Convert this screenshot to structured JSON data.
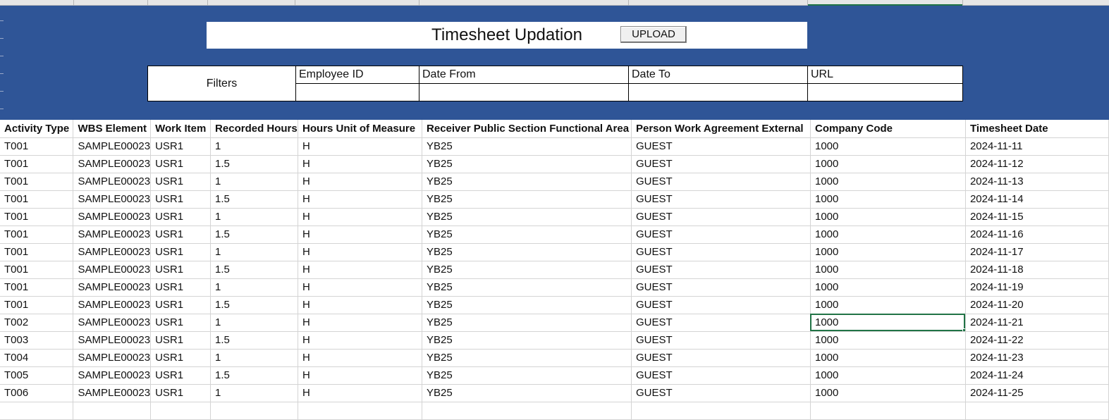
{
  "header": {
    "title": "Timesheet Updation",
    "upload_label": "UPLOAD"
  },
  "filters": {
    "label": "Filters",
    "fields": [
      {
        "label": "Employee ID",
        "value": ""
      },
      {
        "label": "Date From",
        "value": ""
      },
      {
        "label": "Date To",
        "value": ""
      },
      {
        "label": "URL",
        "value": ""
      }
    ]
  },
  "table": {
    "columns": [
      "Activity Type",
      "WBS Element",
      "Work Item",
      "Recorded Hours",
      "Hours Unit of Measure",
      "Receiver Public Section Functional Area",
      "Person Work Agreement External",
      "Company Code",
      "Timesheet Date"
    ],
    "rows": [
      [
        "T001",
        "SAMPLE00023",
        "USR1",
        "1",
        "H",
        "YB25",
        "GUEST",
        "1000",
        "2024-11-11"
      ],
      [
        "T001",
        "SAMPLE00023",
        "USR1",
        "1.5",
        "H",
        "YB25",
        "GUEST",
        "1000",
        "2024-11-12"
      ],
      [
        "T001",
        "SAMPLE00023",
        "USR1",
        "1",
        "H",
        "YB25",
        "GUEST",
        "1000",
        "2024-11-13"
      ],
      [
        "T001",
        "SAMPLE00023",
        "USR1",
        "1.5",
        "H",
        "YB25",
        "GUEST",
        "1000",
        "2024-11-14"
      ],
      [
        "T001",
        "SAMPLE00023",
        "USR1",
        "1",
        "H",
        "YB25",
        "GUEST",
        "1000",
        "2024-11-15"
      ],
      [
        "T001",
        "SAMPLE00023",
        "USR1",
        "1.5",
        "H",
        "YB25",
        "GUEST",
        "1000",
        "2024-11-16"
      ],
      [
        "T001",
        "SAMPLE00023",
        "USR1",
        "1",
        "H",
        "YB25",
        "GUEST",
        "1000",
        "2024-11-17"
      ],
      [
        "T001",
        "SAMPLE00023",
        "USR1",
        "1.5",
        "H",
        "YB25",
        "GUEST",
        "1000",
        "2024-11-18"
      ],
      [
        "T001",
        "SAMPLE00023",
        "USR1",
        "1",
        "H",
        "YB25",
        "GUEST",
        "1000",
        "2024-11-19"
      ],
      [
        "T001",
        "SAMPLE00023",
        "USR1",
        "1.5",
        "H",
        "YB25",
        "GUEST",
        "1000",
        "2024-11-20"
      ],
      [
        "T002",
        "SAMPLE00023",
        "USR1",
        "1",
        "H",
        "YB25",
        "GUEST",
        "1000",
        "2024-11-21"
      ],
      [
        "T003",
        "SAMPLE00023",
        "USR1",
        "1.5",
        "H",
        "YB25",
        "GUEST",
        "1000",
        "2024-11-22"
      ],
      [
        "T004",
        "SAMPLE00023",
        "USR1",
        "1",
        "H",
        "YB25",
        "GUEST",
        "1000",
        "2024-11-23"
      ],
      [
        "T005",
        "SAMPLE00023",
        "USR1",
        "1.5",
        "H",
        "YB25",
        "GUEST",
        "1000",
        "2024-11-24"
      ],
      [
        "T006",
        "SAMPLE00023",
        "USR1",
        "1",
        "H",
        "YB25",
        "GUEST",
        "1000",
        "2024-11-25"
      ],
      [
        "",
        "",
        "",
        "",
        "",
        "",
        "",
        "",
        ""
      ]
    ]
  },
  "colors": {
    "banner": "#2f5597",
    "selection": "#217346",
    "gridline": "#d4d4d4"
  }
}
